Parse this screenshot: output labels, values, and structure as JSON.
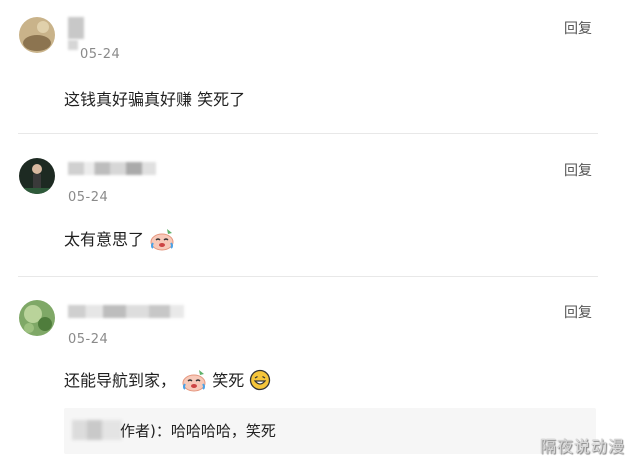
{
  "comments": [
    {
      "date": "05-24",
      "reply_label": "回复",
      "text": "这钱真好骗真好赚 笑死了"
    },
    {
      "date": "05-24",
      "reply_label": "回复",
      "text": "太有意思了"
    },
    {
      "date": "05-24",
      "reply_label": "回复",
      "text_part1": "还能导航到家，",
      "text_part2": "笑死"
    }
  ],
  "sub_reply": {
    "author_suffix": "作者)：",
    "text": "哈哈哈哈，笑死"
  },
  "watermark": "隔夜说动漫",
  "icons": [
    "crying-laughing-emoji-icon",
    "grinning-emoji-icon"
  ]
}
